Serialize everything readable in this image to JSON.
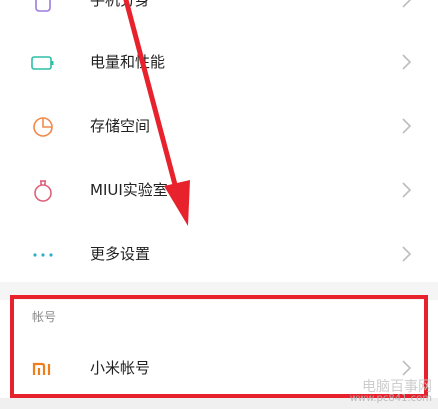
{
  "rows": [
    {
      "label": "手机分身",
      "icon": "phone-clone-icon"
    },
    {
      "label": "电量和性能",
      "icon": "battery-icon"
    },
    {
      "label": "存储空间",
      "icon": "storage-pie-icon"
    },
    {
      "label": "MIUI实验室",
      "icon": "lab-flask-icon"
    },
    {
      "label": "更多设置",
      "icon": "more-dots-icon"
    }
  ],
  "account_section": {
    "title": "帐号",
    "item": {
      "label": "小米帐号",
      "icon": "mi-logo-icon"
    }
  },
  "annotation": {
    "color": "#e8222d"
  },
  "watermark": {
    "line1": "电脑百事网",
    "line2": "www.pc841.com"
  },
  "colors": {
    "battery": "#2dbfa5",
    "storage": "#f08a4b",
    "lab": "#e0607a",
    "more": "#2db0c8",
    "mi": "#f07d1a",
    "clone": "#9b7be0"
  }
}
